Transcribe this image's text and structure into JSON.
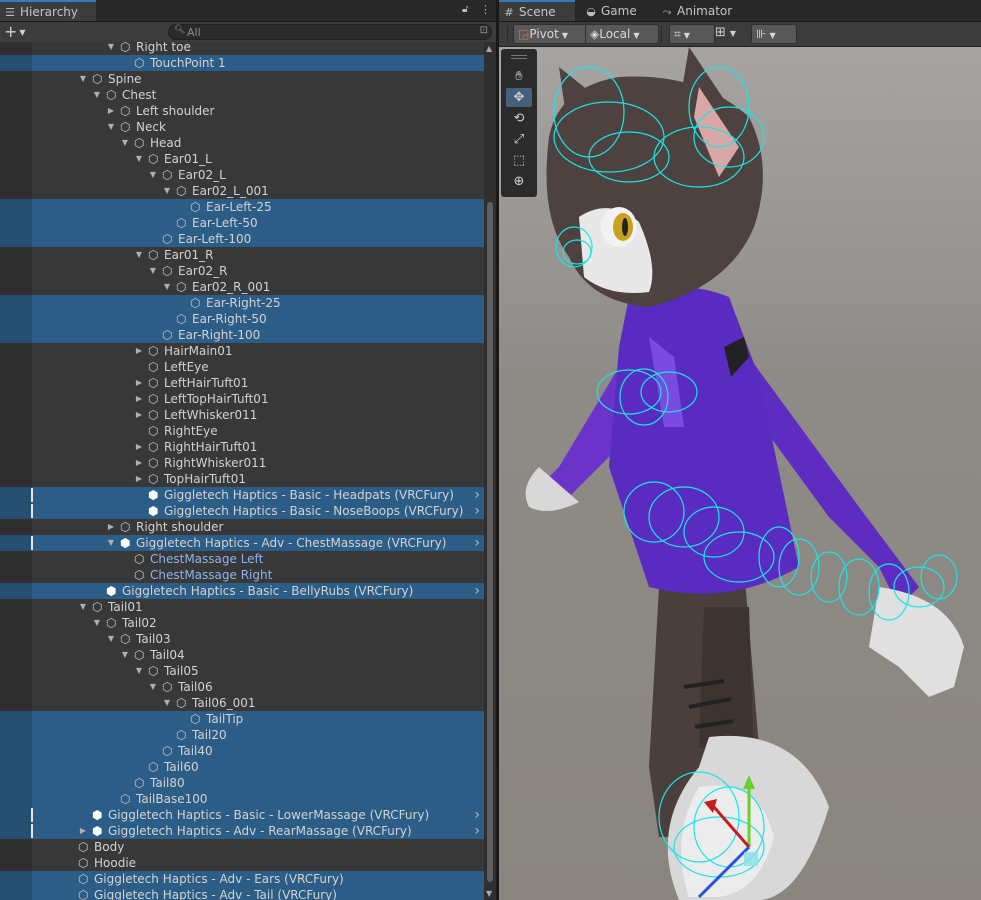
{
  "hierarchy": {
    "tab_label": "Hierarchy",
    "search_placeholder": "All",
    "rows": [
      {
        "label": "Right toe",
        "indent": 5,
        "arrow": "down"
      },
      {
        "label": "TouchPoint 1",
        "indent": 6,
        "sel": true
      },
      {
        "label": "Spine",
        "indent": 3,
        "arrow": "down"
      },
      {
        "label": "Chest",
        "indent": 4,
        "arrow": "down"
      },
      {
        "label": "Left shoulder",
        "indent": 5,
        "arrow": "right"
      },
      {
        "label": "Neck",
        "indent": 5,
        "arrow": "down"
      },
      {
        "label": "Head",
        "indent": 6,
        "arrow": "down"
      },
      {
        "label": "Ear01_L",
        "indent": 7,
        "arrow": "down"
      },
      {
        "label": "Ear02_L",
        "indent": 8,
        "arrow": "down"
      },
      {
        "label": "Ear02_L_001",
        "indent": 9,
        "arrow": "down"
      },
      {
        "label": "Ear-Left-25",
        "indent": 10,
        "sel": true
      },
      {
        "label": "Ear-Left-50",
        "indent": 9,
        "sel": true
      },
      {
        "label": "Ear-Left-100",
        "indent": 8,
        "sel": true
      },
      {
        "label": "Ear01_R",
        "indent": 7,
        "arrow": "down"
      },
      {
        "label": "Ear02_R",
        "indent": 8,
        "arrow": "down"
      },
      {
        "label": "Ear02_R_001",
        "indent": 9,
        "arrow": "down"
      },
      {
        "label": "Ear-Right-25",
        "indent": 10,
        "sel": true
      },
      {
        "label": "Ear-Right-50",
        "indent": 9,
        "sel": true
      },
      {
        "label": "Ear-Right-100",
        "indent": 8,
        "sel": true
      },
      {
        "label": "HairMain01",
        "indent": 7,
        "arrow": "right"
      },
      {
        "label": "LeftEye",
        "indent": 7
      },
      {
        "label": "LeftHairTuft01",
        "indent": 7,
        "arrow": "right"
      },
      {
        "label": "LeftTopHairTuft01",
        "indent": 7,
        "arrow": "right"
      },
      {
        "label": "LeftWhisker011",
        "indent": 7,
        "arrow": "right"
      },
      {
        "label": "RightEye",
        "indent": 7
      },
      {
        "label": "RightHairTuft01",
        "indent": 7,
        "arrow": "right"
      },
      {
        "label": "RightWhisker011",
        "indent": 7,
        "arrow": "right"
      },
      {
        "label": "TopHairTuft01",
        "indent": 7,
        "arrow": "right"
      },
      {
        "label": "Giggletech Haptics - Basic - Headpats (VRCFury)",
        "indent": 7,
        "sel": true,
        "prefab": true,
        "cap": true,
        "chev": true
      },
      {
        "label": "Giggletech Haptics - Basic - NoseBoops (VRCFury)",
        "indent": 7,
        "sel": true,
        "prefab": true,
        "cap": true,
        "chev": true
      },
      {
        "label": "Right shoulder",
        "indent": 5,
        "arrow": "right"
      },
      {
        "label": "Giggletech Haptics - Adv - ChestMassage (VRCFury)",
        "indent": 5,
        "arrow": "down",
        "sel": true,
        "prefab": true,
        "cap": true,
        "chev": true
      },
      {
        "label": "ChestMassage Left",
        "indent": 6,
        "blue": true
      },
      {
        "label": "ChestMassage Right",
        "indent": 6,
        "blue": true
      },
      {
        "label": "Giggletech Haptics - Basic - BellyRubs (VRCFury)",
        "indent": 4,
        "sel": true,
        "prefab": true,
        "chev": true
      },
      {
        "label": "Tail01",
        "indent": 3,
        "arrow": "down"
      },
      {
        "label": "Tail02",
        "indent": 4,
        "arrow": "down"
      },
      {
        "label": "Tail03",
        "indent": 5,
        "arrow": "down"
      },
      {
        "label": "Tail04",
        "indent": 6,
        "arrow": "down"
      },
      {
        "label": "Tail05",
        "indent": 7,
        "arrow": "down"
      },
      {
        "label": "Tail06",
        "indent": 8,
        "arrow": "down"
      },
      {
        "label": "Tail06_001",
        "indent": 9,
        "arrow": "down"
      },
      {
        "label": "TailTip",
        "indent": 10,
        "sel": true
      },
      {
        "label": "Tail20",
        "indent": 9,
        "sel": true
      },
      {
        "label": "Tail40",
        "indent": 8,
        "sel": true
      },
      {
        "label": "Tail60",
        "indent": 7,
        "sel": true
      },
      {
        "label": "Tail80",
        "indent": 6,
        "sel": true
      },
      {
        "label": "TailBase100",
        "indent": 5,
        "sel": true
      },
      {
        "label": "Giggletech Haptics - Basic - LowerMassage (VRCFury)",
        "indent": 3,
        "sel": true,
        "prefab": true,
        "cap": true,
        "chev": true
      },
      {
        "label": "Giggletech Haptics - Adv - RearMassage (VRCFury)",
        "indent": 3,
        "arrow": "right",
        "sel": true,
        "prefab": true,
        "cap": true,
        "chev": true
      },
      {
        "label": "Body",
        "indent": 2
      },
      {
        "label": "Hoodie",
        "indent": 2
      },
      {
        "label": "Giggletech Haptics - Adv - Ears (VRCFury)",
        "indent": 2,
        "sel": true
      },
      {
        "label": "Giggletech Haptics - Adv - Tail (VRCFury)",
        "indent": 2,
        "sel": true
      }
    ]
  },
  "scene": {
    "tabs": [
      {
        "label": "Scene",
        "icon": "grid-icon"
      },
      {
        "label": "Game",
        "icon": "gamepad-icon"
      },
      {
        "label": "Animator",
        "icon": "animator-icon"
      }
    ],
    "pivot_label": "Pivot",
    "local_label": "Local"
  }
}
